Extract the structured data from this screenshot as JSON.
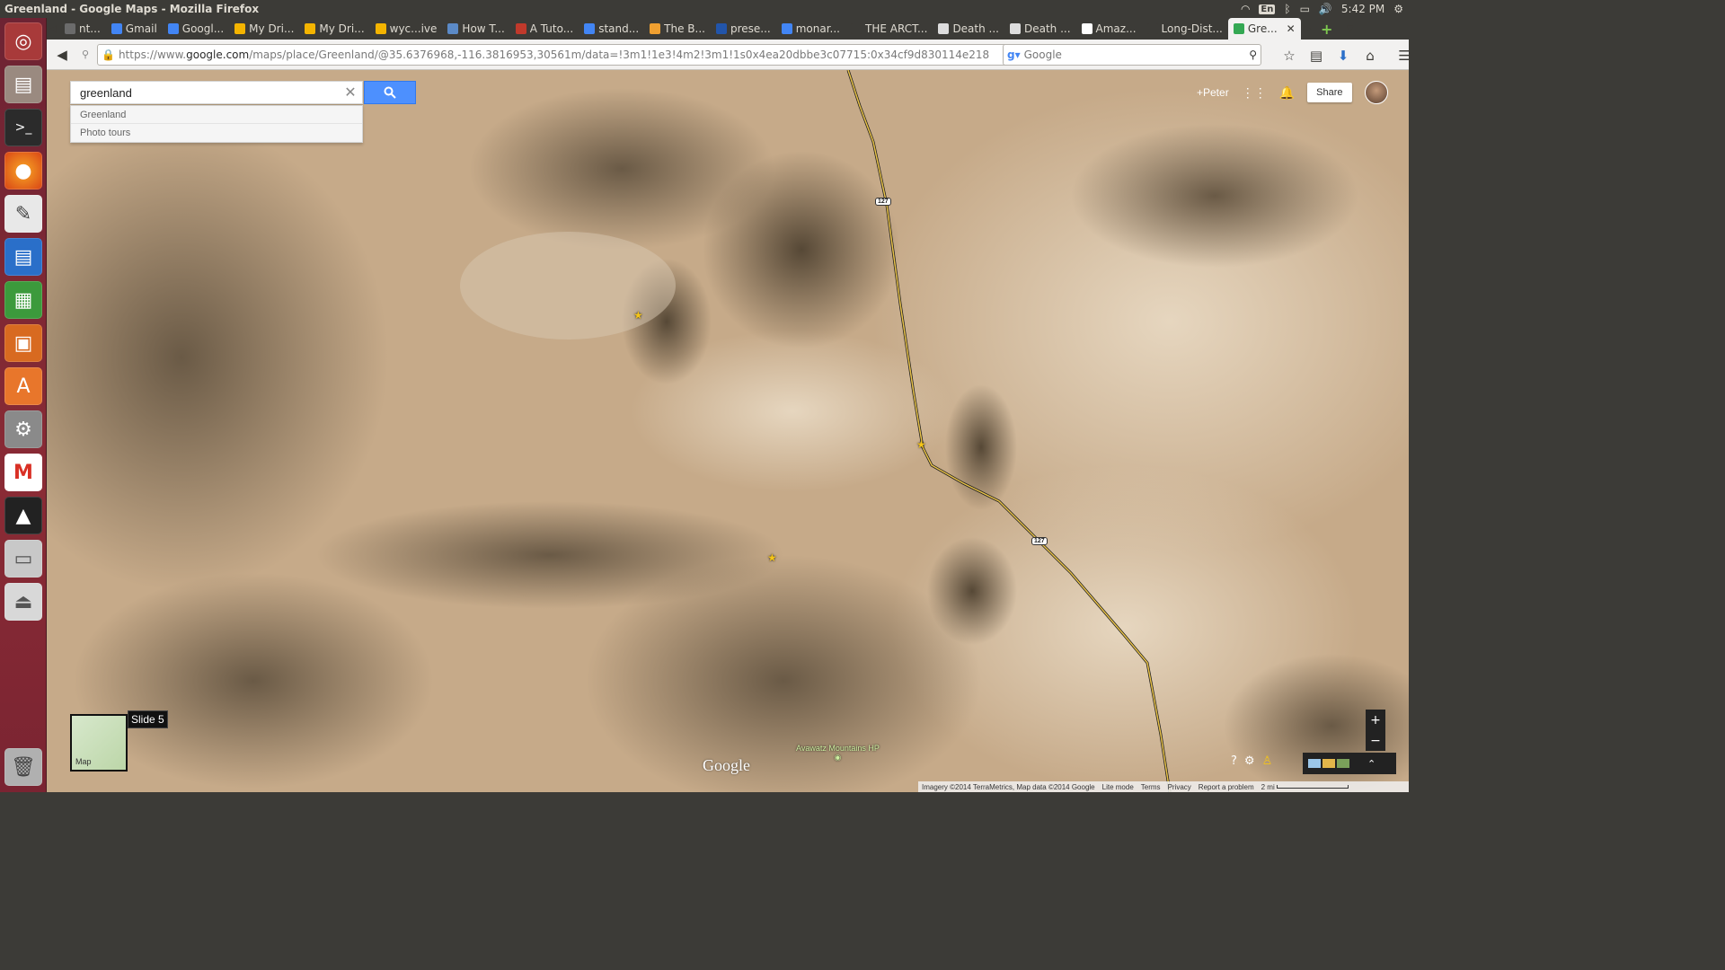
{
  "window": {
    "title": "Greenland - Google Maps - Mozilla Firefox"
  },
  "system": {
    "lang": "En",
    "time": "5:42 PM"
  },
  "tabs": [
    {
      "label": "nt...",
      "color": "#6b6b6b"
    },
    {
      "label": "Gmail",
      "color": "#4285f4"
    },
    {
      "label": "Googl...",
      "color": "#4285f4"
    },
    {
      "label": "My Dri...",
      "color": "#f4b400"
    },
    {
      "label": "My Dri...",
      "color": "#f4b400"
    },
    {
      "label": "wyc...ive",
      "color": "#f4b400"
    },
    {
      "label": "How T...",
      "color": "#5b8ac7"
    },
    {
      "label": "A Tuto...",
      "color": "#c0392b"
    },
    {
      "label": "stand...",
      "color": "#4285f4"
    },
    {
      "label": "The B...",
      "color": "#f0a030"
    },
    {
      "label": "prese...",
      "color": "#2255aa"
    },
    {
      "label": "monar...",
      "color": "#4285f4"
    },
    {
      "label": "THE ARCT...",
      "color": "#3c3b37"
    },
    {
      "label": "Death ...",
      "color": "#dddddd"
    },
    {
      "label": "Death ...",
      "color": "#dddddd"
    },
    {
      "label": "Amaz...",
      "color": "#ffffff"
    },
    {
      "label": "Long-Dist...",
      "color": "#3c3b37"
    },
    {
      "label": "Gre...",
      "color": "#34a853",
      "active": true
    }
  ],
  "nav": {
    "url_prefix": "https://www.",
    "url_domain": "google.com",
    "url_rest": "/maps/place/Greenland/@35.6376968,-116.3816953,30561m/data=!3m1!1e3!4m2!3m1!1s0x4ea20dbbe3c07715:0x34cf9d830114e218",
    "search_placeholder": "Google"
  },
  "maps": {
    "search_value": "greenland",
    "suggestions": [
      "Greenland",
      "Photo tours"
    ],
    "user": "+Peter",
    "share_label": "Share",
    "minimap_label": "Map",
    "tooltip": "Slide 5",
    "zoom_in": "+",
    "zoom_out": "−",
    "logo": "Google",
    "poi_label": "Avawatz Mountains HP",
    "route_shield": "127",
    "footer": {
      "imagery": "Imagery ©2014 TerraMetrics, Map data ©2014 Google",
      "lite": "Lite mode",
      "terms": "Terms",
      "privacy": "Privacy",
      "report": "Report a problem",
      "scale": "2 mi"
    }
  }
}
